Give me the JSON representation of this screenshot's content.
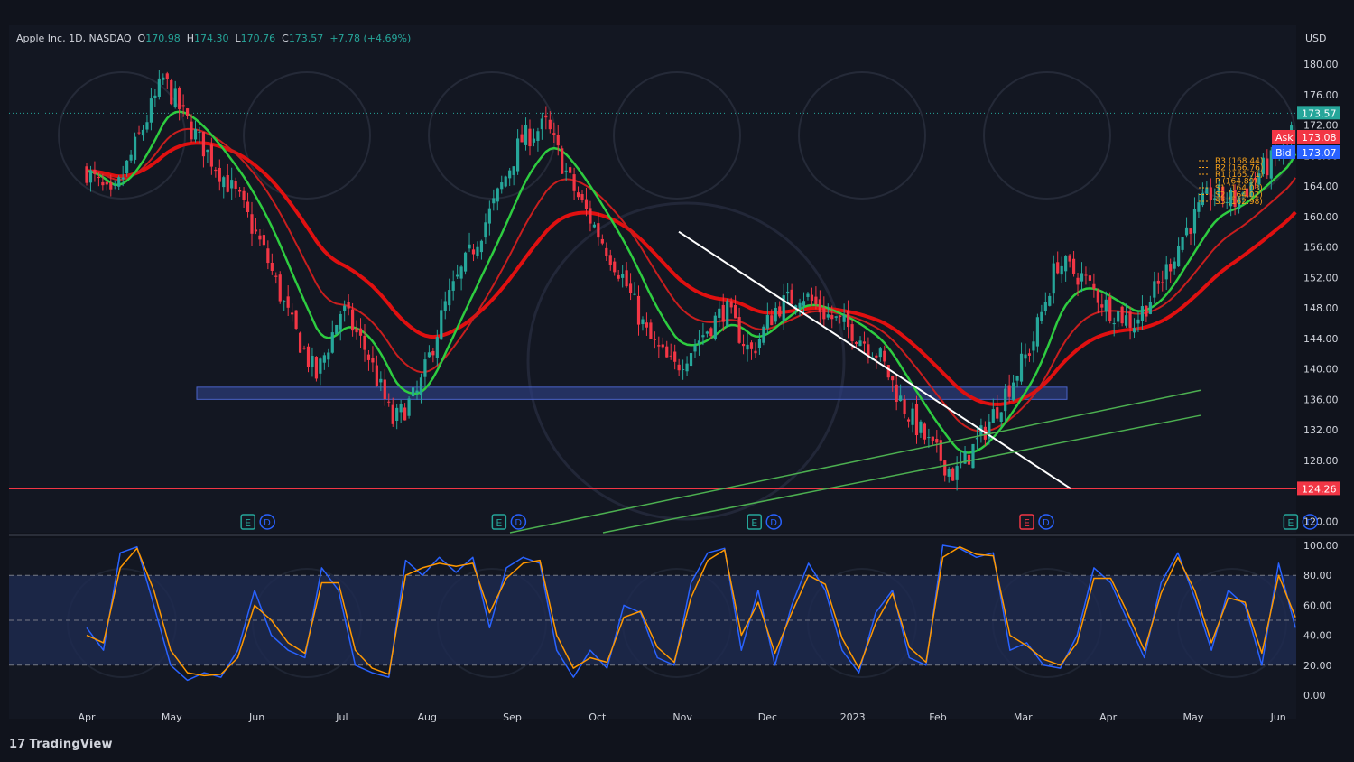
{
  "header": {
    "symbol": "Apple Inc, 1D, NASDAQ",
    "o_label": "O",
    "o_value": "170.98",
    "h_label": "H",
    "h_value": "174.30",
    "l_label": "L",
    "l_value": "170.76",
    "c_label": "C",
    "c_value": "173.57",
    "change": "+7.78 (+4.69%)"
  },
  "currency": "USD",
  "branding": "TradingView",
  "price_badges": {
    "last": "173.57",
    "ask_label": "Ask",
    "ask": "173.08",
    "bid_label": "Bid",
    "bid": "173.07",
    "support": "124.26"
  },
  "pivot_labels": [
    "R3 (168.44)",
    "R2 (166.76)",
    "R1 (165.71)",
    "P (164.89)",
    "S1 (164.03)",
    "S2 (164.02)",
    "S3 (162.98)"
  ],
  "event_markers": [
    {
      "month_index": 1.9,
      "types": [
        "E",
        "D"
      ],
      "earn_color": "#26a69a"
    },
    {
      "month_index": 4.85,
      "types": [
        "E",
        "D"
      ],
      "earn_color": "#26a69a"
    },
    {
      "month_index": 7.85,
      "types": [
        "E",
        "D"
      ],
      "earn_color": "#26a69a"
    },
    {
      "month_index": 11.05,
      "types": [
        "E",
        "D"
      ],
      "earn_color": "#f23645"
    },
    {
      "month_index": 14.15,
      "types": [
        "E",
        "D"
      ],
      "earn_color": "#26a69a"
    }
  ],
  "colors": {
    "bg": "#131722",
    "up": "#26a69a",
    "down": "#f23645",
    "ma_red": "#e01010",
    "ma_green": "#2ecc40",
    "osc_k": "#2962ff",
    "osc_d": "#ff9800",
    "zone": "#3a4a8a"
  },
  "chart_data": {
    "type": "candlestick",
    "title": "Apple Inc, 1D, NASDAQ",
    "x_ticks": [
      "Apr",
      "May",
      "Jun",
      "Jul",
      "Aug",
      "Sep",
      "Oct",
      "Nov",
      "Dec",
      "2023",
      "Feb",
      "Mar",
      "Apr",
      "May",
      "Jun"
    ],
    "y_ticks": [
      "120.00",
      "124.00",
      "128.00",
      "132.00",
      "136.00",
      "140.00",
      "144.00",
      "148.00",
      "152.00",
      "156.00",
      "160.00",
      "164.00",
      "168.00",
      "172.00",
      "176.00",
      "180.00"
    ],
    "ylim": [
      118.5,
      182.5
    ],
    "price_path": [
      [
        0,
        166
      ],
      [
        0.3,
        162
      ],
      [
        0.6,
        170
      ],
      [
        0.9,
        178
      ],
      [
        1.2,
        172
      ],
      [
        1.5,
        167
      ],
      [
        1.8,
        162
      ],
      [
        2.1,
        155
      ],
      [
        2.4,
        146
      ],
      [
        2.7,
        139
      ],
      [
        3.0,
        148
      ],
      [
        3.3,
        142
      ],
      [
        3.6,
        133
      ],
      [
        3.9,
        137
      ],
      [
        4.2,
        148
      ],
      [
        4.5,
        155
      ],
      [
        4.8,
        162
      ],
      [
        5.1,
        170
      ],
      [
        5.4,
        172
      ],
      [
        5.7,
        164
      ],
      [
        6.0,
        158
      ],
      [
        6.3,
        152
      ],
      [
        6.6,
        144
      ],
      [
        6.9,
        140
      ],
      [
        7.2,
        144
      ],
      [
        7.5,
        148
      ],
      [
        7.8,
        142
      ],
      [
        8.1,
        148
      ],
      [
        8.4,
        150
      ],
      [
        8.7,
        147
      ],
      [
        9.0,
        145
      ],
      [
        9.3,
        142
      ],
      [
        9.6,
        135
      ],
      [
        9.9,
        130
      ],
      [
        10.2,
        126
      ],
      [
        10.5,
        131
      ],
      [
        10.8,
        137
      ],
      [
        11.1,
        143
      ],
      [
        11.4,
        154
      ],
      [
        11.7,
        152
      ],
      [
        12.0,
        148
      ],
      [
        12.3,
        146
      ],
      [
        12.6,
        151
      ],
      [
        12.9,
        158
      ],
      [
        13.2,
        163
      ],
      [
        13.5,
        162
      ],
      [
        13.8,
        166
      ],
      [
        14.1,
        169
      ],
      [
        14.2,
        173.6
      ]
    ],
    "series": [
      {
        "name": "Price (OHLC)",
        "values": "price_path"
      }
    ],
    "oscillator": {
      "y_ticks": [
        "100.00",
        "80.00",
        "60.00",
        "40.00",
        "20.00",
        "0.00"
      ],
      "upper_band": 80,
      "mid_band": 50,
      "lower_band": 20,
      "k_values": [
        45,
        30,
        95,
        99,
        60,
        20,
        10,
        15,
        12,
        30,
        70,
        40,
        30,
        25,
        85,
        70,
        20,
        15,
        12,
        90,
        80,
        92,
        82,
        92,
        45,
        85,
        92,
        88,
        30,
        12,
        30,
        18,
        60,
        55,
        25,
        20,
        75,
        95,
        98,
        30,
        70,
        20,
        60,
        88,
        70,
        30,
        15,
        55,
        70,
        25,
        20,
        100,
        98,
        92,
        95,
        30,
        35,
        20,
        18,
        40,
        85,
        75,
        50,
        25,
        75,
        95,
        65,
        30,
        70,
        60,
        20,
        88,
        45
      ],
      "d_values": [
        40,
        35,
        85,
        98,
        70,
        30,
        15,
        13,
        14,
        25,
        60,
        50,
        35,
        28,
        75,
        75,
        30,
        18,
        14,
        80,
        85,
        88,
        86,
        88,
        55,
        78,
        88,
        90,
        40,
        18,
        25,
        22,
        52,
        56,
        32,
        22,
        65,
        90,
        97,
        40,
        62,
        28,
        55,
        80,
        74,
        38,
        18,
        48,
        68,
        32,
        22,
        92,
        99,
        94,
        93,
        40,
        33,
        24,
        20,
        35,
        78,
        78,
        55,
        30,
        68,
        92,
        70,
        35,
        65,
        62,
        28,
        80,
        52
      ]
    }
  }
}
